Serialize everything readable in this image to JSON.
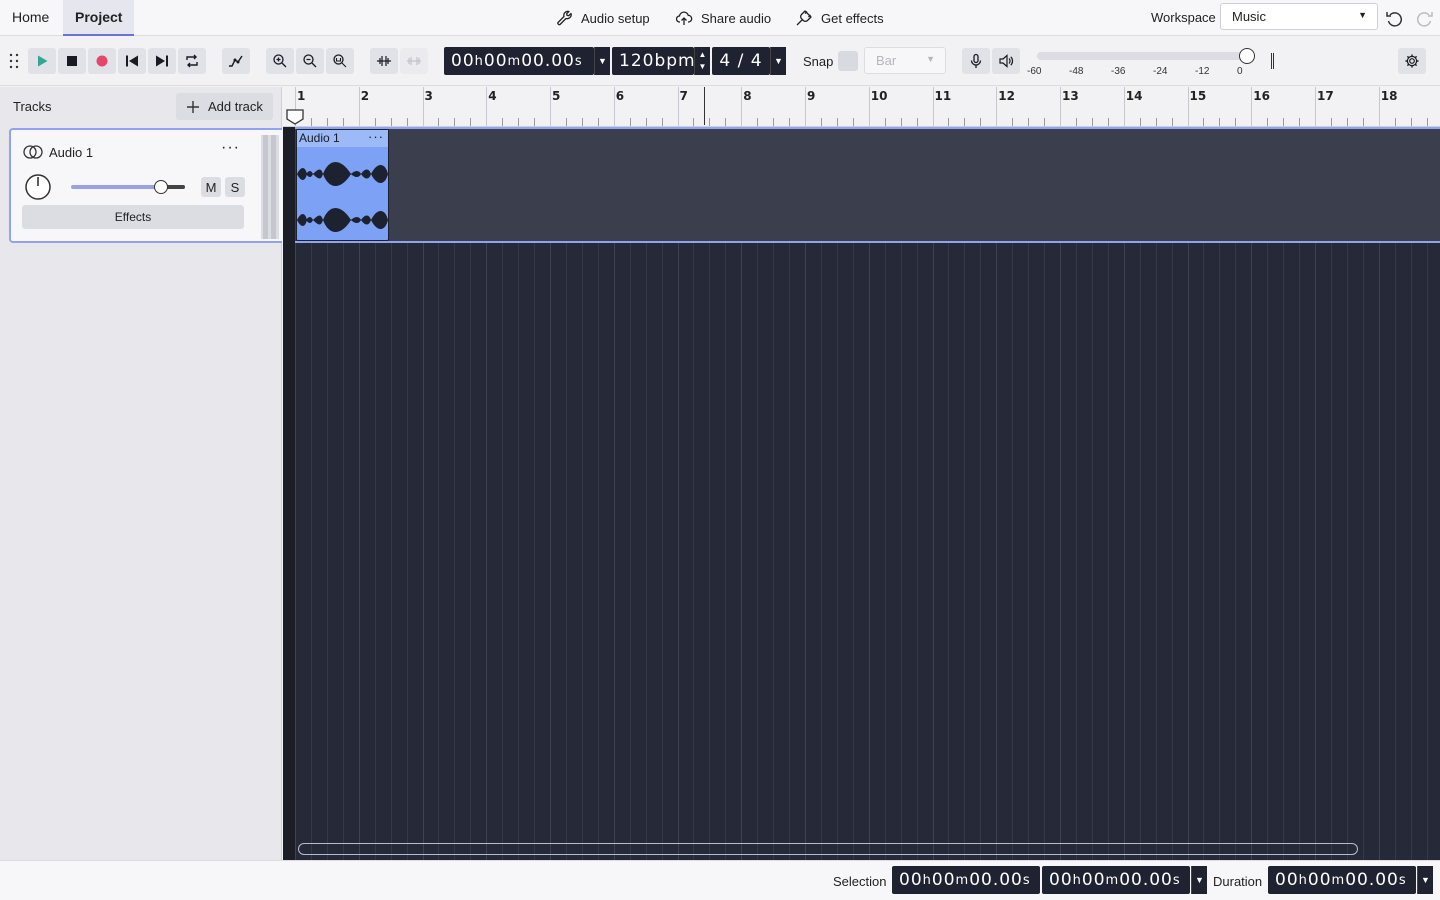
{
  "tabs": [
    {
      "label": "Home",
      "active": false
    },
    {
      "label": "Project",
      "active": true
    }
  ],
  "top_actions": {
    "audio_setup": "Audio setup",
    "share_audio": "Share audio",
    "get_effects": "Get effects"
  },
  "workspace": {
    "label": "Workspace",
    "selected": "Music"
  },
  "toolbar": {
    "time_hh": "00",
    "time_mm": "00",
    "time_ss": "00.00",
    "tempo_value": "120",
    "tempo_unit": "bpm",
    "time_signature": "4 / 4",
    "snap_label": "Snap",
    "snap_value": "Bar",
    "meter_ticks": [
      "-60",
      "-48",
      "-36",
      "-24",
      "-12",
      "0"
    ],
    "playback_volume_level": 1.0
  },
  "tracks_panel": {
    "title": "Tracks",
    "add_track": "Add track"
  },
  "tracks": [
    {
      "name": "Audio 1",
      "mute": "M",
      "solo": "S",
      "effects": "Effects",
      "volume_level": 0.8,
      "pan": 0
    }
  ],
  "ruler": {
    "bars": [
      "1",
      "2",
      "3",
      "4",
      "5",
      "6",
      "7",
      "8",
      "9",
      "10",
      "11",
      "12",
      "13",
      "14",
      "15",
      "16",
      "17",
      "18"
    ]
  },
  "clips": [
    {
      "title": "Audio 1",
      "menu": "···"
    }
  ],
  "bottom_bar": {
    "selection_label": "Selection",
    "selection_start": {
      "hh": "00",
      "mm": "00",
      "ss": "00.00"
    },
    "selection_end": {
      "hh": "00",
      "mm": "00",
      "ss": "00.00"
    },
    "duration_label": "Duration",
    "duration": {
      "hh": "00",
      "mm": "00",
      "ss": "00.00"
    }
  },
  "colors": {
    "accent": "#6b72d9",
    "track_highlight": "#8fa3f0",
    "clip": "#7da2f5",
    "timeline_bg": "#262a38",
    "play": "#2fa891",
    "record": "#e6466a"
  },
  "icons": {
    "play": "play-icon",
    "stop": "stop-icon",
    "record": "record-icon",
    "skip_start": "skip-to-start-icon",
    "skip_end": "skip-to-end-icon",
    "loop": "loop-icon",
    "automation": "automation-icon",
    "zoom_in": "zoom-in-icon",
    "zoom_out": "zoom-out-icon",
    "zoom_fit": "zoom-fit-icon",
    "trim": "trim-icon",
    "silence": "silence-icon",
    "mic": "microphone-icon",
    "speaker": "speaker-icon",
    "settings": "gear-icon"
  }
}
